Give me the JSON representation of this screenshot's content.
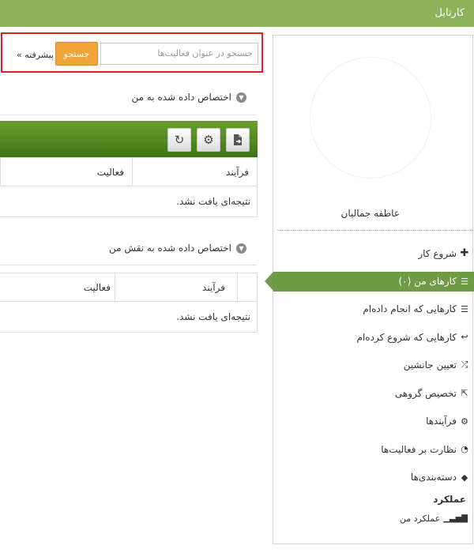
{
  "header": {
    "title": "کارتابل"
  },
  "search": {
    "placeholder": "جستجو در عنوان فعالیت‌ها",
    "button_label": "جستجو",
    "advanced_label": "پیشرفته »"
  },
  "panel1": {
    "title": "اختصاص داده شده به من",
    "toolbar": {
      "icons": [
        "export-icon",
        "gear-icon",
        "refresh-icon"
      ]
    },
    "columns": [
      "فرآیند",
      "فعالیت"
    ],
    "empty_text": "نتیجه‌ای یافت نشد."
  },
  "panel2": {
    "title": "اختصاص داده شده به نقش من",
    "columns": [
      "فرآیند",
      "فعالیت"
    ],
    "empty_text": "نتیجه‌ای یافت نشد."
  },
  "sidebar": {
    "username": "عاطفه جمالیان",
    "items": [
      {
        "label": "شروع کار",
        "icon": "plus-icon"
      },
      {
        "label": "کارهای من (۰)",
        "icon": "list-icon",
        "active": true
      },
      {
        "label": "کارهایی که انجام داده‌ام",
        "icon": "list-icon"
      },
      {
        "label": "کارهایی که شروع کرده‌ام",
        "icon": "reply-icon"
      },
      {
        "label": "تعیین جانشین",
        "icon": "shuffle-icon"
      },
      {
        "label": "تخصیص گروهی",
        "icon": "share-icon"
      },
      {
        "label": "فرآیندها",
        "icon": "cogs-icon"
      },
      {
        "label": "نظارت بر فعالیت‌ها",
        "icon": "dashboard-icon"
      },
      {
        "label": "دسته‌بندی‌ها",
        "icon": "tags-icon"
      }
    ],
    "performance_title": "عملکرد",
    "performance_item": "عملکرد من"
  },
  "colors": {
    "header": "#8db35a",
    "active_item": "#6f9a46",
    "search_button": "#f0a43a",
    "highlight_border": "#d9242b",
    "toolbar": "#4f8a1f"
  }
}
